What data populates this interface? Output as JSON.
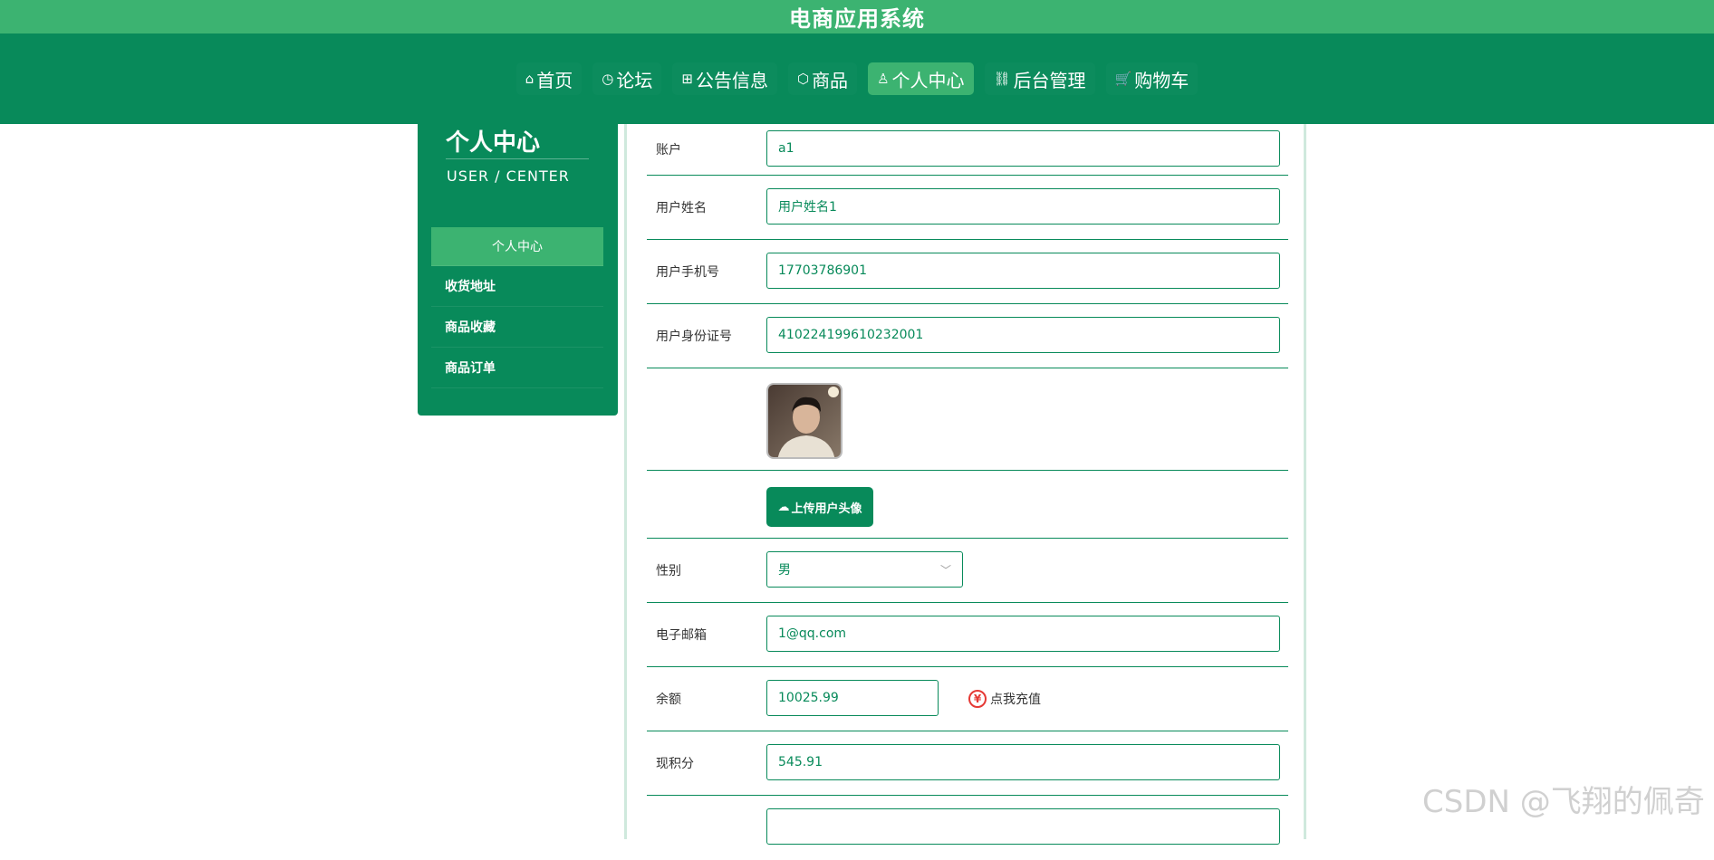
{
  "app_title": "电商应用系统",
  "nav": [
    {
      "icon": "⌂",
      "label": "首页",
      "active": false
    },
    {
      "icon": "◷",
      "label": "论坛",
      "active": false
    },
    {
      "icon": "⊞",
      "label": "公告信息",
      "active": false
    },
    {
      "icon": "⬡",
      "label": "商品",
      "active": false
    },
    {
      "icon": "♙",
      "label": "个人中心",
      "active": true
    },
    {
      "icon": "⛓",
      "label": "后台管理",
      "active": false
    },
    {
      "icon": "🛒",
      "label": "购物车",
      "active": false
    }
  ],
  "sidebar": {
    "title": "个人中心",
    "subtitle": "USER / CENTER",
    "items": [
      {
        "label": "个人中心",
        "active": true
      },
      {
        "label": "收货地址",
        "active": false
      },
      {
        "label": "商品收藏",
        "active": false
      },
      {
        "label": "商品订单",
        "active": false
      }
    ]
  },
  "form": {
    "account": {
      "label": "账户",
      "value": "a1"
    },
    "name": {
      "label": "用户姓名",
      "value": "用户姓名1"
    },
    "phone": {
      "label": "用户手机号",
      "value": "17703786901"
    },
    "id_card": {
      "label": "用户身份证号",
      "value": "410224199610232001"
    },
    "upload_label": "上传用户头像",
    "gender": {
      "label": "性别",
      "value": "男"
    },
    "email": {
      "label": "电子邮箱",
      "value": "1@qq.com"
    },
    "balance": {
      "label": "余额",
      "value": "10025.99"
    },
    "recharge_label": "点我充值",
    "yen_symbol": "¥",
    "points": {
      "label": "现积分",
      "value": "545.91"
    }
  },
  "watermark": "CSDN @飞翔的佩奇",
  "colors": {
    "primary": "#088a5a",
    "accent": "#3cb371",
    "danger": "#e53935"
  }
}
